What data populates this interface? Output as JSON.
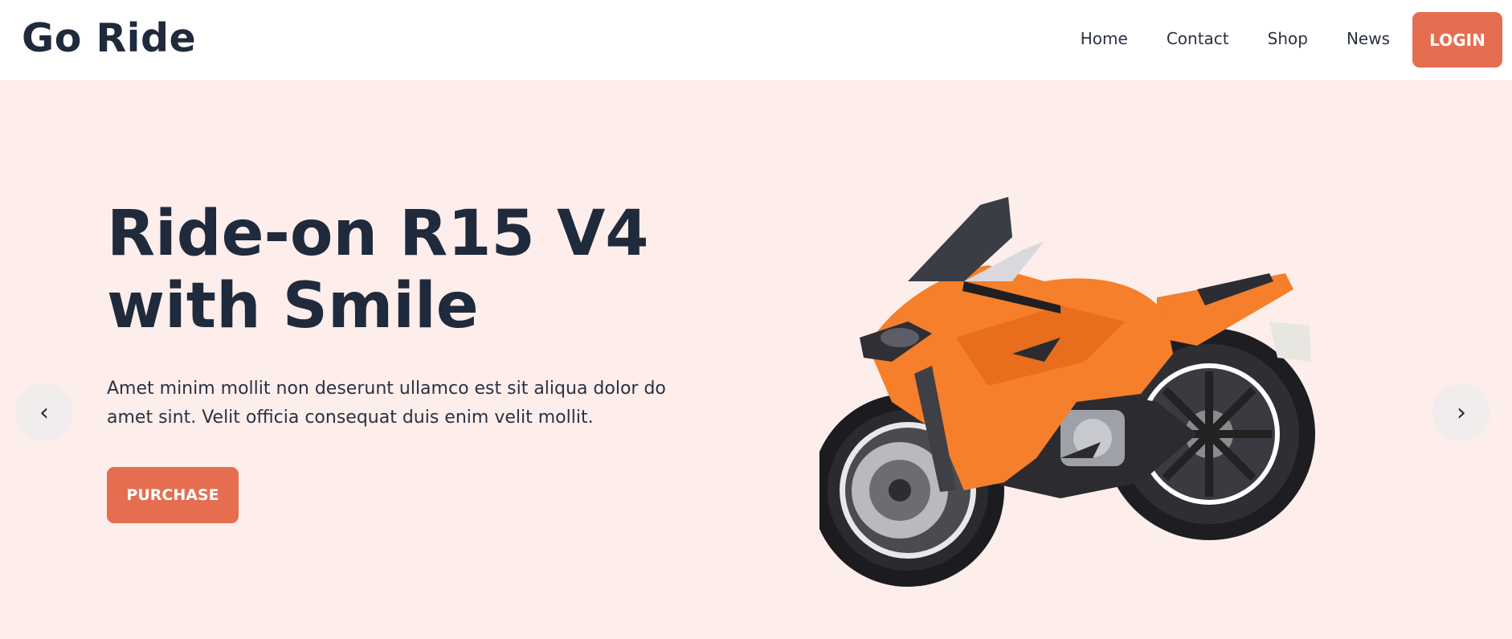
{
  "brand": {
    "name": "Go Ride"
  },
  "nav": {
    "links": [
      {
        "label": "Home"
      },
      {
        "label": "Contact"
      },
      {
        "label": "Shop"
      },
      {
        "label": "News"
      }
    ],
    "login_label": "LOGIN"
  },
  "hero": {
    "title": "Ride-on R15 V4 with Smile",
    "description": "Amet minim mollit non deserunt ullamco est sit aliqua dolor do amet sint. Velit officia consequat duis enim velit mollit.",
    "purchase_label": "PURCHASE",
    "prev_arrow": "‹",
    "next_arrow": "›"
  },
  "colors": {
    "accent": "#e56e50",
    "hero_background": "#fdeeeb",
    "text_dark": "#1f2a3c",
    "bike_body": "#f57f2b"
  },
  "icons": {
    "prev": "chevron-left-icon",
    "next": "chevron-right-icon"
  }
}
